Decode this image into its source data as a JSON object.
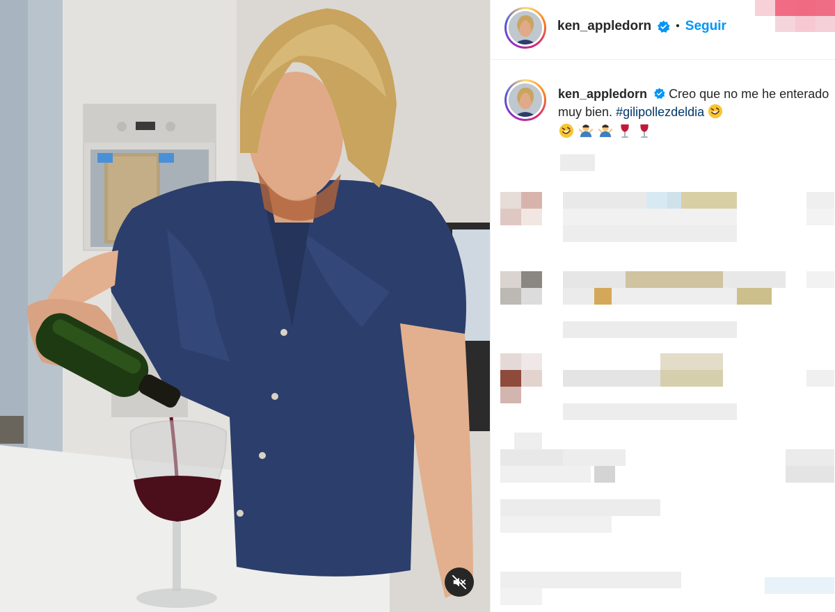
{
  "post": {
    "username": "ken_appledorn",
    "verified": true,
    "separator": "•",
    "follow_label": "Seguir",
    "caption": {
      "text": "Creo que no me he enterado muy bien.",
      "hashtag": "#gilipollezdeldia",
      "emojis": [
        "rolling-laughing",
        "rolling-laughing",
        "person-shrugging",
        "person-shrugging",
        "wine-glass",
        "wine-glass"
      ]
    }
  },
  "media": {
    "type": "video",
    "muted": true,
    "mute_icon": "speaker-muted-icon"
  },
  "colors": {
    "accent": "#0095f6",
    "hashtag": "#00376b",
    "text": "#262626",
    "shirt": "#2c3e6b",
    "wine": "#4a0f1a"
  }
}
